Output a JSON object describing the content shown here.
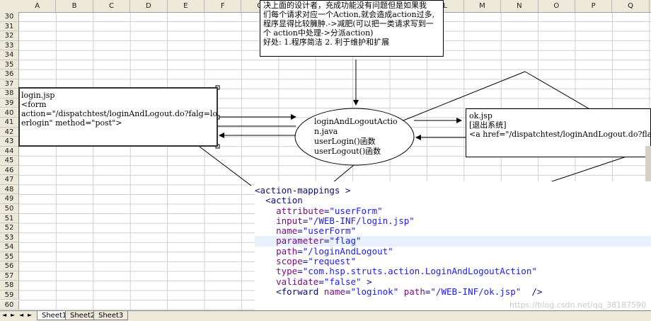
{
  "columns": [
    "A",
    "B",
    "C",
    "D",
    "E",
    "F",
    "G",
    "H",
    "I",
    "J",
    "K",
    "L",
    "M",
    "N",
    "O",
    "P",
    "Q"
  ],
  "rows": [
    "30",
    "31",
    "32",
    "33",
    "34",
    "35",
    "36",
    "37",
    "38",
    "39",
    "40",
    "41",
    "42",
    "43",
    "44",
    "45",
    "46",
    "47",
    "48",
    "49",
    "50",
    "51",
    "52",
    "53",
    "54",
    "55",
    "56",
    "57",
    "58",
    "59",
    "60"
  ],
  "note_box": {
    "lines": [
      "决上面的设计者，充成功能没有问题但是如果我",
      "们每个请求对应一个Action,就会造成action过多,",
      "程序显得比较臃肿.->减肥(可以把一类请求写到一",
      "个 action中处理->分派action)",
      "好处: 1.程序简洁 2. 利于维护和扩展"
    ]
  },
  "login_box": {
    "lines": [
      "login.jsp",
      "<form",
      "action=\"/dispatchtest/loginAndLogout.do?falg=lo",
      "erlogin\" method=\"post\">"
    ]
  },
  "ellipse": {
    "lines": [
      "loginAndLogoutActio",
      "n.java",
      "userLogin()函数",
      "userLogout()函数"
    ]
  },
  "ok_box": {
    "lines": [
      "ok.jsp",
      "[退出系统]",
      "<a href=\"/dispatchtest/loginAndLogout.do?fla"
    ]
  },
  "code": {
    "lines": [
      {
        "indent": "",
        "parts": [
          [
            "tag",
            "<action-mappings >"
          ]
        ]
      },
      {
        "indent": "  ",
        "parts": [
          [
            "tag",
            "<action"
          ]
        ]
      },
      {
        "indent": "    ",
        "parts": [
          [
            "attr",
            "attribute"
          ],
          [
            "tag",
            "="
          ],
          [
            "val",
            "\"userForm\""
          ]
        ]
      },
      {
        "indent": "    ",
        "parts": [
          [
            "attr",
            "input"
          ],
          [
            "tag",
            "="
          ],
          [
            "val",
            "\"/WEB-INF/login.jsp\""
          ]
        ]
      },
      {
        "indent": "    ",
        "parts": [
          [
            "attr",
            "name"
          ],
          [
            "tag",
            "="
          ],
          [
            "val",
            "\"userForm\""
          ]
        ]
      },
      {
        "indent": "    ",
        "parts": [
          [
            "attr",
            "parameter"
          ],
          [
            "tag",
            "="
          ],
          [
            "val",
            "\"flag\""
          ]
        ],
        "highlight": true
      },
      {
        "indent": "    ",
        "parts": [
          [
            "attr",
            "path"
          ],
          [
            "tag",
            "="
          ],
          [
            "val",
            "\"/loginAndLogout\""
          ]
        ]
      },
      {
        "indent": "    ",
        "parts": [
          [
            "attr",
            "scope"
          ],
          [
            "tag",
            "="
          ],
          [
            "val",
            "\"request\""
          ]
        ]
      },
      {
        "indent": "    ",
        "parts": [
          [
            "attr",
            "type"
          ],
          [
            "tag",
            "="
          ],
          [
            "val",
            "\"com.hsp.struts.action.LoginAndLogoutAction\""
          ]
        ]
      },
      {
        "indent": "    ",
        "parts": [
          [
            "attr",
            "validate"
          ],
          [
            "tag",
            "="
          ],
          [
            "val",
            "\"false\""
          ],
          [
            "tag",
            " >"
          ]
        ]
      },
      {
        "indent": "    ",
        "parts": [
          [
            "tag",
            "<forward "
          ],
          [
            "attr",
            "name"
          ],
          [
            "tag",
            "="
          ],
          [
            "val",
            "\"loginok\""
          ],
          [
            "tag",
            " "
          ],
          [
            "attr",
            "path"
          ],
          [
            "tag",
            "="
          ],
          [
            "val",
            "\"/WEB-INF/ok.jsp\""
          ],
          [
            "tag",
            "  />"
          ]
        ]
      }
    ]
  },
  "sheet_tabs": [
    "Sheet1",
    "Sheet2",
    "Sheet3"
  ],
  "nav_glyphs": [
    "◄",
    "►",
    "◄",
    "►"
  ],
  "watermark": "https://blog.csdn.net/qq_38187590"
}
